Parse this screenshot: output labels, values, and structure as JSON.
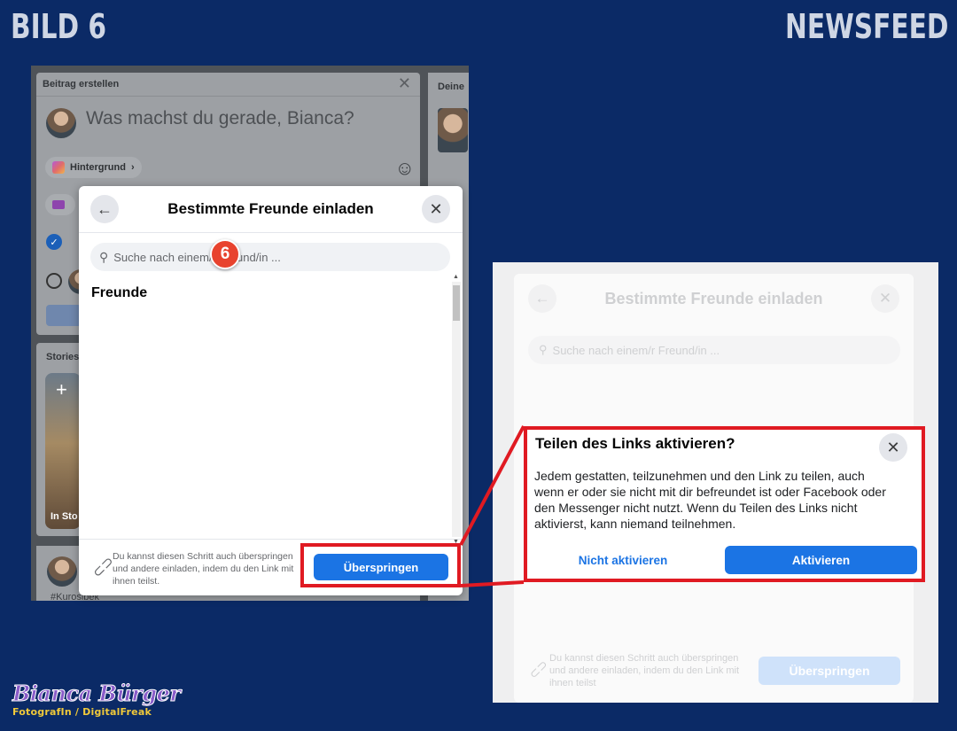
{
  "header": {
    "left": "BILD 6",
    "right": "NEWSFEED"
  },
  "colors": {
    "background": "#0b2a66",
    "accent": "#1b74e4",
    "highlight": "#e01a22",
    "badge": "#e8432e"
  },
  "left_screen": {
    "post_card": {
      "title": "Beitrag erstellen",
      "prompt": "Was machst du gerade, Bianca?",
      "background_pill": "Hintergrund",
      "icons": [
        "close-icon",
        "smiley-icon",
        "background-icon"
      ]
    },
    "side_title": "Deine",
    "stories_title": "Stories",
    "story_label": "In Sto",
    "hashtag": "#Kurosibek",
    "dialog": {
      "title": "Bestimmte Freunde einladen",
      "search_placeholder": "Suche nach einem/r Freund/in ...",
      "section": "Freunde",
      "footer_text": "Du kannst diesen Schritt auch überspringen und andere einladen, indem du den Link mit ihnen teilst.",
      "skip_button": "Überspringen",
      "step_badge": "6"
    }
  },
  "right_screen": {
    "dialog": {
      "title": "Bestimmte Freunde einladen",
      "search_placeholder": "Suche nach einem/r Freund/in ...",
      "footer_text": "Du kannst diesen Schritt auch überspringen und andere einladen, indem du den Link mit ihnen teilst",
      "skip_button": "Überspringen"
    },
    "confirm": {
      "title": "Teilen des Links aktivieren?",
      "body": "Jedem gestatten, teilzunehmen und den Link zu teilen, auch wenn er oder sie nicht mit dir befreundet ist oder Facebook oder den Messenger nicht nutzt. Wenn du Teilen des Links nicht aktivierst, kann niemand teilnehmen.",
      "deny_button": "Nicht aktivieren",
      "accept_button": "Aktivieren"
    }
  },
  "brand": {
    "name": "Bianca Bürger",
    "subtitle": "FotografIn / DigitalFreak"
  }
}
